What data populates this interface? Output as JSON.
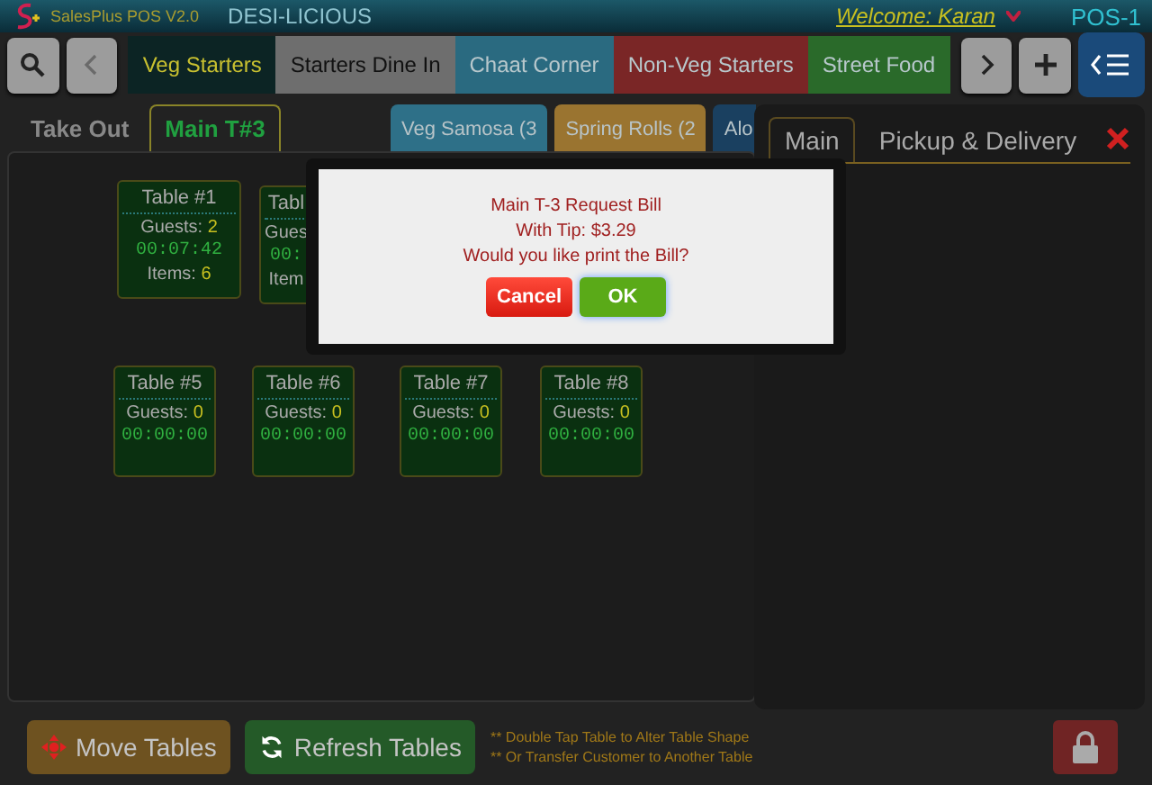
{
  "header": {
    "app_name": "SalesPlus POS V2.0",
    "store": "DESI-LICIOUS",
    "welcome": "Welcome: Karan",
    "terminal": "POS-1"
  },
  "categories": [
    {
      "label": "Veg Starters",
      "selected": true,
      "color": "#0c2424"
    },
    {
      "label": "Starters Dine In",
      "selected": false,
      "color": "#6e6e6e"
    },
    {
      "label": "Chaat Corner",
      "selected": false,
      "color": "#2a6a80"
    },
    {
      "label": "Non-Veg Starters",
      "selected": false,
      "color": "#7a2626"
    },
    {
      "label": "Street Food",
      "selected": false,
      "color": "#2a6a2a"
    }
  ],
  "order_tabs": [
    {
      "label": "Take Out",
      "selected": false
    },
    {
      "label": "Main T#3",
      "selected": true
    }
  ],
  "menu_items": [
    {
      "label": "Veg Samosa (3",
      "color": "#2e7088"
    },
    {
      "label": "Spring Rolls (2",
      "color": "#9a7430"
    },
    {
      "label": "Alo",
      "color": "#1a4060"
    }
  ],
  "right_panel": {
    "tabs": [
      {
        "label": "Main",
        "selected": true
      },
      {
        "label": "Pickup & Delivery",
        "selected": false
      }
    ]
  },
  "tables": [
    {
      "name": "Table #1",
      "guests_label": "Guests:",
      "guests": "2",
      "timer": "00:07:42",
      "items_label": "Items:",
      "items": "6"
    },
    {
      "name": "Tabl",
      "guests_label": "Gues",
      "timer": "00:",
      "items_label": "Item"
    },
    {
      "name": "Table #5",
      "guests_label": "Guests:",
      "guests": "0",
      "timer": "00:00:00"
    },
    {
      "name": "Table #6",
      "guests_label": "Guests:",
      "guests": "0",
      "timer": "00:00:00"
    },
    {
      "name": "Table #7",
      "guests_label": "Guests:",
      "guests": "0",
      "timer": "00:00:00"
    },
    {
      "name": "Table #8",
      "guests_label": "Guests:",
      "guests": "0",
      "timer": "00:00:00"
    }
  ],
  "actions": [
    {
      "label": "Move Tables",
      "kind": "move"
    },
    {
      "label": "Refresh Tables",
      "kind": "refresh"
    }
  ],
  "hints": [
    "** Double Tap Table to Alter Table Shape",
    "** Or Transfer Customer to Another Table"
  ],
  "dialog": {
    "lines": [
      "Main T-3 Request Bill",
      "With Tip: $3.29",
      "Would you like print the Bill?"
    ],
    "buttons": [
      {
        "label": "Cancel",
        "kind": "cancel"
      },
      {
        "label": "OK",
        "kind": "ok"
      }
    ]
  }
}
